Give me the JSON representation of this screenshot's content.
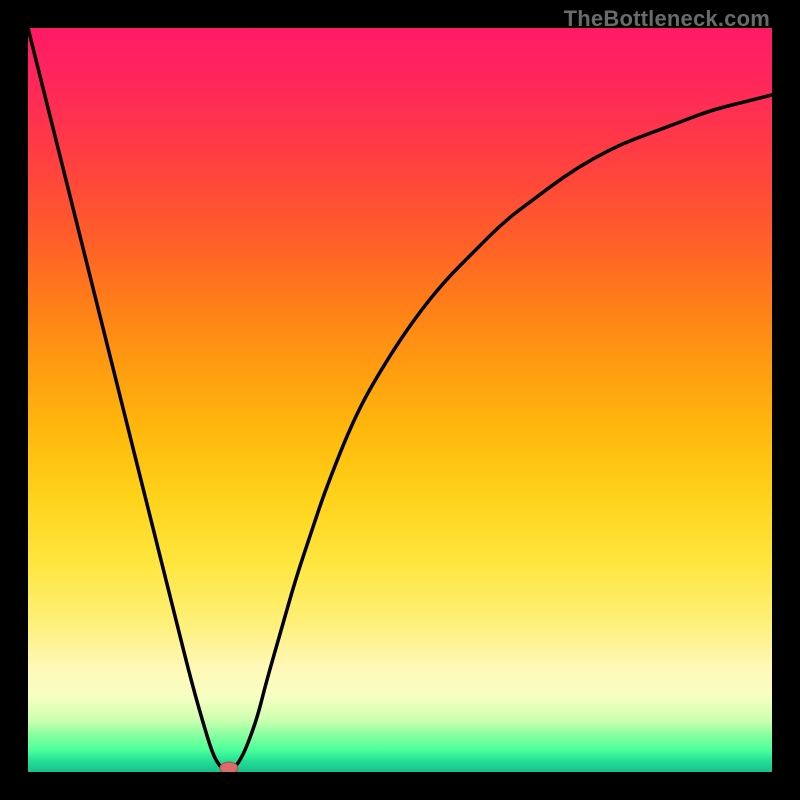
{
  "watermark": "TheBottleneck.com",
  "colors": {
    "page_bg": "#000000",
    "curve": "#000000",
    "marker_fill": "#d96b6b",
    "marker_stroke": "#a84a4a",
    "watermark": "#6a6a6a",
    "gradient_top": "#ff1a66",
    "gradient_bottom": "#16c08c"
  },
  "chart_data": {
    "type": "line",
    "title": "",
    "xlabel": "",
    "ylabel": "",
    "xlim": [
      0,
      100
    ],
    "ylim": [
      0,
      100
    ],
    "grid": false,
    "legend_position": "none",
    "x": [
      0,
      2,
      4,
      6,
      8,
      10,
      12,
      14,
      16,
      18,
      20,
      22,
      24,
      25,
      26,
      27,
      28,
      29,
      30,
      31,
      32,
      34,
      36,
      38,
      40,
      44,
      48,
      52,
      56,
      60,
      64,
      68,
      72,
      76,
      80,
      84,
      88,
      92,
      96,
      100
    ],
    "values": [
      100,
      92,
      84,
      76,
      68,
      60,
      52,
      44,
      36,
      28,
      20,
      12,
      5,
      2,
      0.5,
      0,
      0.8,
      2.5,
      5,
      8,
      12,
      19,
      26,
      32,
      38,
      48,
      55,
      61,
      66,
      70,
      74,
      77,
      80,
      82.5,
      84.5,
      86,
      87.5,
      89,
      90,
      91
    ],
    "marker": {
      "x": 27,
      "y": 0
    }
  }
}
